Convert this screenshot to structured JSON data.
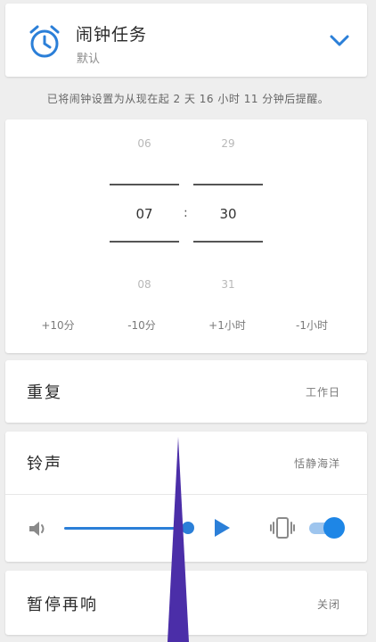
{
  "header": {
    "title": "闹钟任务",
    "subtitle": "默认",
    "clock_icon": "alarm-clock-icon",
    "chevron_icon": "chevron-down-icon",
    "accent": "#2b7fd8"
  },
  "notice": "已将闹钟设置为从现在起 2 天 16 小时 11 分钟后提醒。",
  "picker": {
    "hour": {
      "prev": "06",
      "current": "07",
      "next": "08"
    },
    "minute": {
      "prev": "29",
      "current": "30",
      "next": "31"
    },
    "separator": ":",
    "quick_buttons": [
      "+10分",
      "-10分",
      "+1小时",
      "-1小时"
    ]
  },
  "repeat": {
    "label": "重复",
    "value": "工作日"
  },
  "ringtone": {
    "label": "铃声",
    "value": "恬静海洋",
    "volume_level": 0.97,
    "vibrate_enabled": true,
    "icons": [
      "speaker-icon",
      "play-icon",
      "vibrate-icon"
    ]
  },
  "snooze": {
    "label": "暂停再响",
    "value": "关闭"
  }
}
